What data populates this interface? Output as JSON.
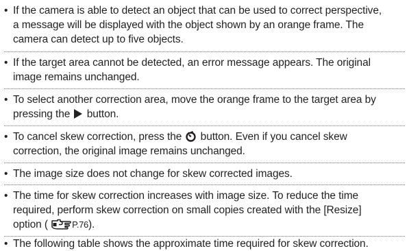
{
  "bullet": "•",
  "notes": [
    {
      "lines": [
        "If the camera is able to detect an object that can be used to correct perspective,",
        "a message will be displayed with the object shown by an orange frame. The",
        "camera can detect up to five objects."
      ]
    },
    {
      "lines": [
        "If the target area cannot be detected, an error message appears. The original",
        "image remains unchanged."
      ]
    },
    {
      "lines": [
        "To select another correction area, move the orange frame to the target area by"
      ],
      "line2_before": "pressing the",
      "line2_after": "button."
    },
    {
      "line1_before": "To cancel skew correction, press the",
      "line1_after": "button. Even if you cancel skew",
      "lines": [
        "correction, the original image remains unchanged."
      ]
    },
    {
      "lines": [
        "The image size does not change for skew corrected images."
      ]
    },
    {
      "lines": [
        "The time for skew correction increases with image size. To reduce the time",
        "required, perform skew correction on small copies created with the [Resize]"
      ],
      "line3_before": "option (",
      "page_ref": "P.76",
      "line3_after": ")."
    },
    {
      "lines": [
        "The following table shows the approximate time required for skew correction."
      ]
    }
  ],
  "icons": {
    "right_button": "play-right-triangle-icon",
    "self_timer_button": "self-timer-icon",
    "page_reference": "page-reference-hand-icon"
  }
}
